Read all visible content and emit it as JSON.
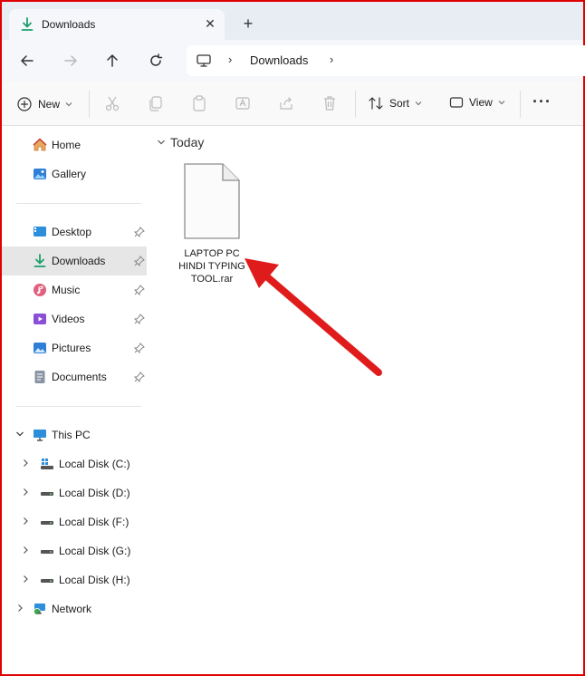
{
  "window": {
    "tab_title": "Downloads",
    "tab_icon": "download-icon",
    "close_glyph": "✕",
    "newtab_glyph": "+"
  },
  "address": {
    "location_icon": "computer-icon",
    "separator": "›",
    "path": [
      "Downloads"
    ]
  },
  "toolbar": {
    "new_label": "New",
    "sort_label": "Sort",
    "view_label": "View",
    "more_glyph": "···"
  },
  "sidebar": {
    "quick": [
      {
        "label": "Home",
        "icon": "home-icon"
      },
      {
        "label": "Gallery",
        "icon": "gallery-icon"
      }
    ],
    "pinned": [
      {
        "label": "Desktop",
        "icon": "desktop-icon",
        "pinned": true
      },
      {
        "label": "Downloads",
        "icon": "download-icon",
        "pinned": true,
        "selected": true
      },
      {
        "label": "Music",
        "icon": "music-icon",
        "pinned": true
      },
      {
        "label": "Videos",
        "icon": "videos-icon",
        "pinned": true
      },
      {
        "label": "Pictures",
        "icon": "pictures-icon",
        "pinned": true
      },
      {
        "label": "Documents",
        "icon": "documents-icon",
        "pinned": true
      }
    ],
    "this_pc": {
      "label": "This PC",
      "icon": "computer-icon",
      "expanded": true
    },
    "drives": [
      {
        "label": "Local Disk (C:)",
        "icon": "windows-drive-icon"
      },
      {
        "label": "Local Disk (D:)",
        "icon": "drive-icon"
      },
      {
        "label": "Local Disk (F:)",
        "icon": "drive-icon"
      },
      {
        "label": "Local Disk (G:)",
        "icon": "drive-icon"
      },
      {
        "label": "Local Disk (H:)",
        "icon": "drive-icon"
      }
    ],
    "network": {
      "label": "Network",
      "icon": "network-icon"
    }
  },
  "main": {
    "group_label": "Today",
    "files": [
      {
        "name": "LAPTOP PC HINDI TYPING TOOL.rar",
        "icon": "blank-file-icon"
      }
    ]
  },
  "annotation": {
    "arrow_color": "#e01b1b",
    "frame_color": "#e00000"
  }
}
